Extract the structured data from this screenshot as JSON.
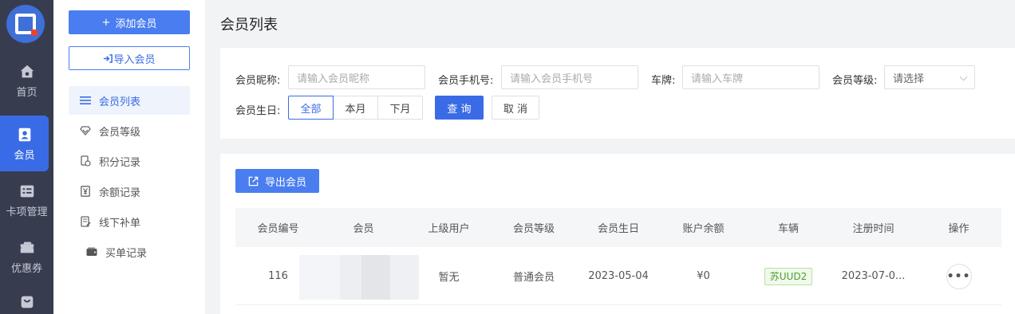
{
  "rail": {
    "items": [
      {
        "label": "首页",
        "icon": "home-icon"
      },
      {
        "label": "会员",
        "icon": "member-card-icon",
        "active": true
      },
      {
        "label": "卡项管理",
        "icon": "card-list-icon"
      },
      {
        "label": "优惠券",
        "icon": "coupon-icon"
      },
      {
        "label": "",
        "icon": "shopping-bag-icon"
      }
    ]
  },
  "submenu": {
    "add_label": "添加会员",
    "add_icon": "+",
    "import_label": "导入会员",
    "items": [
      {
        "label": "会员列表",
        "icon": "list-icon",
        "active": true
      },
      {
        "label": "会员等级",
        "icon": "diamond-icon"
      },
      {
        "label": "积分记录",
        "icon": "points-icon"
      },
      {
        "label": "余额记录",
        "icon": "yen-icon"
      },
      {
        "label": "线下补单",
        "icon": "order-edit-icon"
      },
      {
        "label": "买单记录",
        "icon": "wallet-icon"
      }
    ]
  },
  "page_title": "会员列表",
  "filters": {
    "nickname_label": "会员昵称:",
    "nickname_placeholder": "请输入会员昵称",
    "phone_label": "会员手机号:",
    "phone_placeholder": "请输入会员手机号",
    "plate_label": "车牌:",
    "plate_placeholder": "请输入车牌",
    "level_label": "会员等级:",
    "level_placeholder": "请选择",
    "birthday_label": "会员生日:",
    "birthday_options": [
      "全部",
      "本月",
      "下月"
    ],
    "birthday_selected": "全部",
    "query_label": "查 询",
    "cancel_label": "取 消"
  },
  "table": {
    "export_label": "导出会员",
    "columns": [
      "会员编号",
      "会员",
      "上级用户",
      "会员等级",
      "会员生日",
      "账户余额",
      "车辆",
      "注册时间",
      "操作"
    ],
    "rows": [
      {
        "id": "116",
        "member": "",
        "parent": "暂无",
        "level": "普通会员",
        "birthday": "2023-05-04",
        "balance": "¥0",
        "vehicle": "苏UUD2",
        "registered": "2023-07-0...",
        "action": "•••"
      }
    ]
  },
  "colors": {
    "accent": "#3a6be6",
    "rail_bg": "#373d4f",
    "plate_green": "#4f9d2e"
  }
}
